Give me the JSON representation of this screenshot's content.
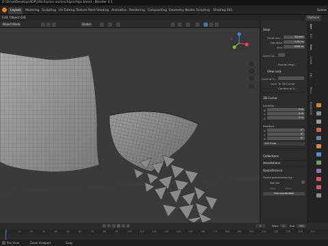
{
  "titlebar": {
    "text": "D:\\Drive\\Desktop\\ADP\\3d\\chips\\cs-sachs\\chips\\chips.blend - Blender 4.1"
  },
  "workspaces": [
    {
      "label": "Layout",
      "active": true
    },
    {
      "label": "Modeling"
    },
    {
      "label": "Sculpting"
    },
    {
      "label": "UV Editing"
    },
    {
      "label": "Texture Paint"
    },
    {
      "label": "Shading"
    },
    {
      "label": "Animation"
    },
    {
      "label": "Rendering"
    },
    {
      "label": "Compositing"
    },
    {
      "label": "Geometry Nodes"
    },
    {
      "label": "Scripting"
    },
    {
      "label": "Shading.001"
    }
  ],
  "scene_label": "Scene",
  "menu": {
    "items": [
      "Edit",
      "Object",
      "GIS"
    ],
    "options_label": "Options"
  },
  "viewport_header": {
    "mode": "Object Mode",
    "transform": "Global"
  },
  "npanel": {
    "view": {
      "title": "View",
      "focal_label": "Focal Len...",
      "focal_value": "50 mm",
      "clip_start_label": "Clip Start",
      "clip_start_value": "0.01 m",
      "end_label": "End",
      "end_value": "1000 m",
      "local_camera_label": "Local Ca...",
      "render_region_label": "Render Regi...",
      "view_lock_title": "View Lock",
      "lock_to_object_label": "Lock to O...",
      "lock_label": "Lock",
      "to_3d_cursor_label": "To 3D Cursor",
      "camera_to_view_label": "Camera to V..."
    },
    "cursor": {
      "title": "3D Cursor",
      "location_label": "Location :",
      "location": [
        {
          "axis": "X",
          "value": "0 m"
        },
        {
          "axis": "Y",
          "value": "0 m"
        },
        {
          "axis": "Z",
          "value": "0 m"
        }
      ],
      "rotation_label": "Rotation :",
      "rotation": [
        {
          "axis": "X",
          "value": "0°"
        },
        {
          "axis": "Y",
          "value": "0°"
        },
        {
          "axis": "Z",
          "value": "0°"
        }
      ],
      "rotation_mode": "XYZ Euler"
    },
    "collections_label": "Collections",
    "annotations_label": "Annotations",
    "georef": {
      "title": "Georeference",
      "scene_geo_label": "Scene georeferencing :",
      "not_set": "Not set",
      "east_label": "East",
      "north_label": "North",
      "geo_coords_label": "Geo coordinates"
    }
  },
  "side_tabs": [
    "Item",
    "Tool",
    "View",
    "Create",
    "Edit",
    "Photo",
    "BlenderGIS"
  ],
  "timeline": {
    "start_label": "Start",
    "start_value": "1",
    "end_label": "End",
    "end_value": "250",
    "current_frame": "1",
    "ticks": [
      "0",
      "10",
      "20",
      "30",
      "40",
      "50",
      "60",
      "70",
      "80",
      "90",
      "100",
      "110",
      "120",
      "130",
      "140",
      "150",
      "160",
      "170",
      "180",
      "190",
      "200",
      "210",
      "220",
      "230",
      "240",
      "250"
    ]
  },
  "statusbar": {
    "items": [
      "Pan View",
      "Zoom Viewport",
      "Snap"
    ]
  },
  "colors": {
    "accent": "#4772b3",
    "gizmo_x": "#e84454",
    "gizmo_y": "#7fbd2c",
    "gizmo_z": "#3e87e0"
  }
}
